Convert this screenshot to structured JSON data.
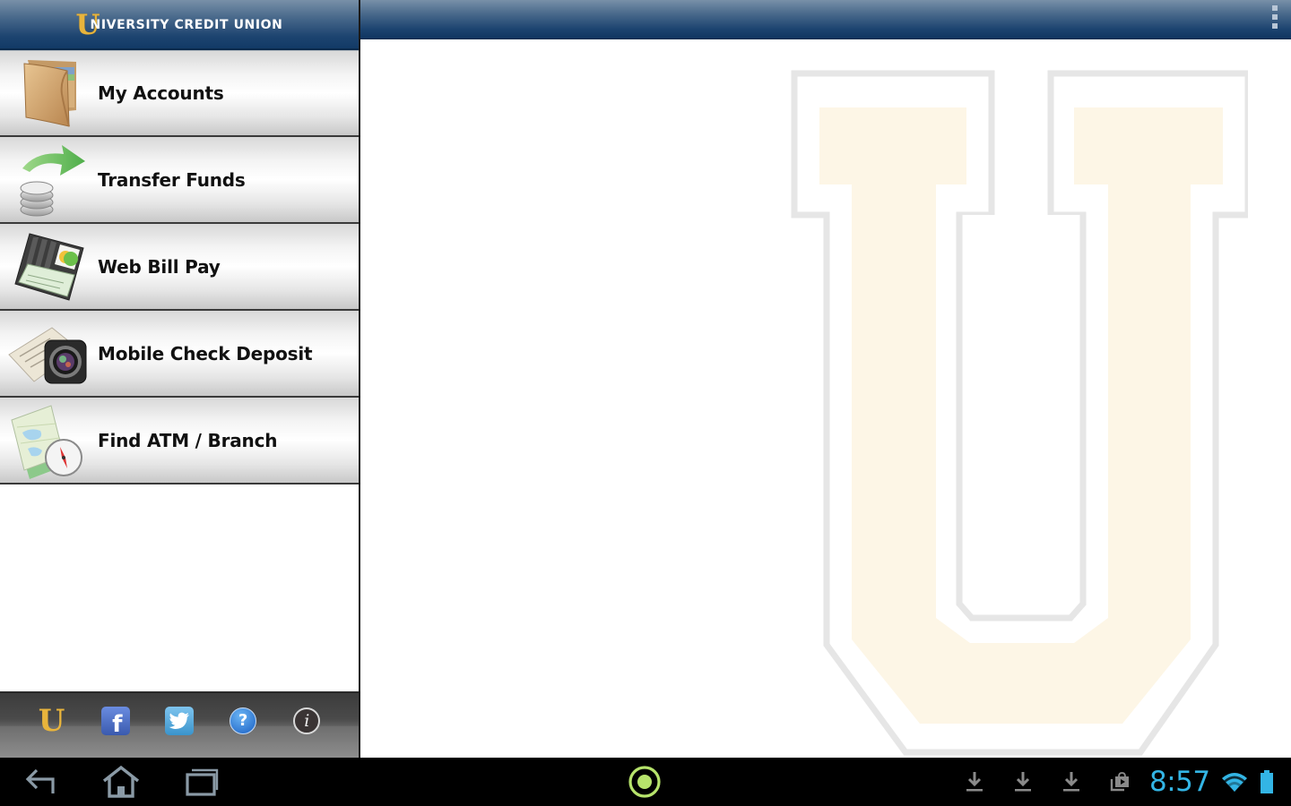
{
  "app": {
    "brand_letter": "U",
    "brand_name": "NIVERSITY CREDIT UNION",
    "brand_full": "University Credit Union",
    "colors": {
      "header_blue": "#1d4470",
      "brand_gold": "#e8b43c",
      "watermark_fill": "#fdf6e6",
      "watermark_outline": "#e8e8e8",
      "clock_blue": "#33b5e5",
      "home_green": "#b6e36b"
    }
  },
  "menu": {
    "items": [
      {
        "label": "My Accounts",
        "icon": "wallet-icon"
      },
      {
        "label": "Transfer Funds",
        "icon": "transfer-coins-icon"
      },
      {
        "label": "Web Bill Pay",
        "icon": "checkbook-icon"
      },
      {
        "label": "Mobile Check Deposit",
        "icon": "camera-check-icon"
      },
      {
        "label": "Find ATM / Branch",
        "icon": "map-compass-icon"
      }
    ]
  },
  "social_bar": {
    "items": [
      {
        "name": "ucu-home",
        "icon": "u-logo-icon",
        "glyph": "U"
      },
      {
        "name": "facebook",
        "icon": "facebook-icon",
        "glyph": "f"
      },
      {
        "name": "twitter",
        "icon": "twitter-icon",
        "glyph": ""
      },
      {
        "name": "help",
        "icon": "help-icon",
        "glyph": "?"
      },
      {
        "name": "info",
        "icon": "info-icon",
        "glyph": "i"
      }
    ]
  },
  "action_bar": {
    "overflow_icon": "overflow-menu-icon"
  },
  "system_bar": {
    "clock": "8:57",
    "nav": [
      "back-icon",
      "home-icon",
      "recent-apps-icon"
    ],
    "center": "circle-home-icon",
    "notifications": [
      "download-icon",
      "download-icon",
      "download-icon",
      "play-store-icon"
    ],
    "status": [
      "wifi-icon",
      "battery-icon"
    ]
  }
}
